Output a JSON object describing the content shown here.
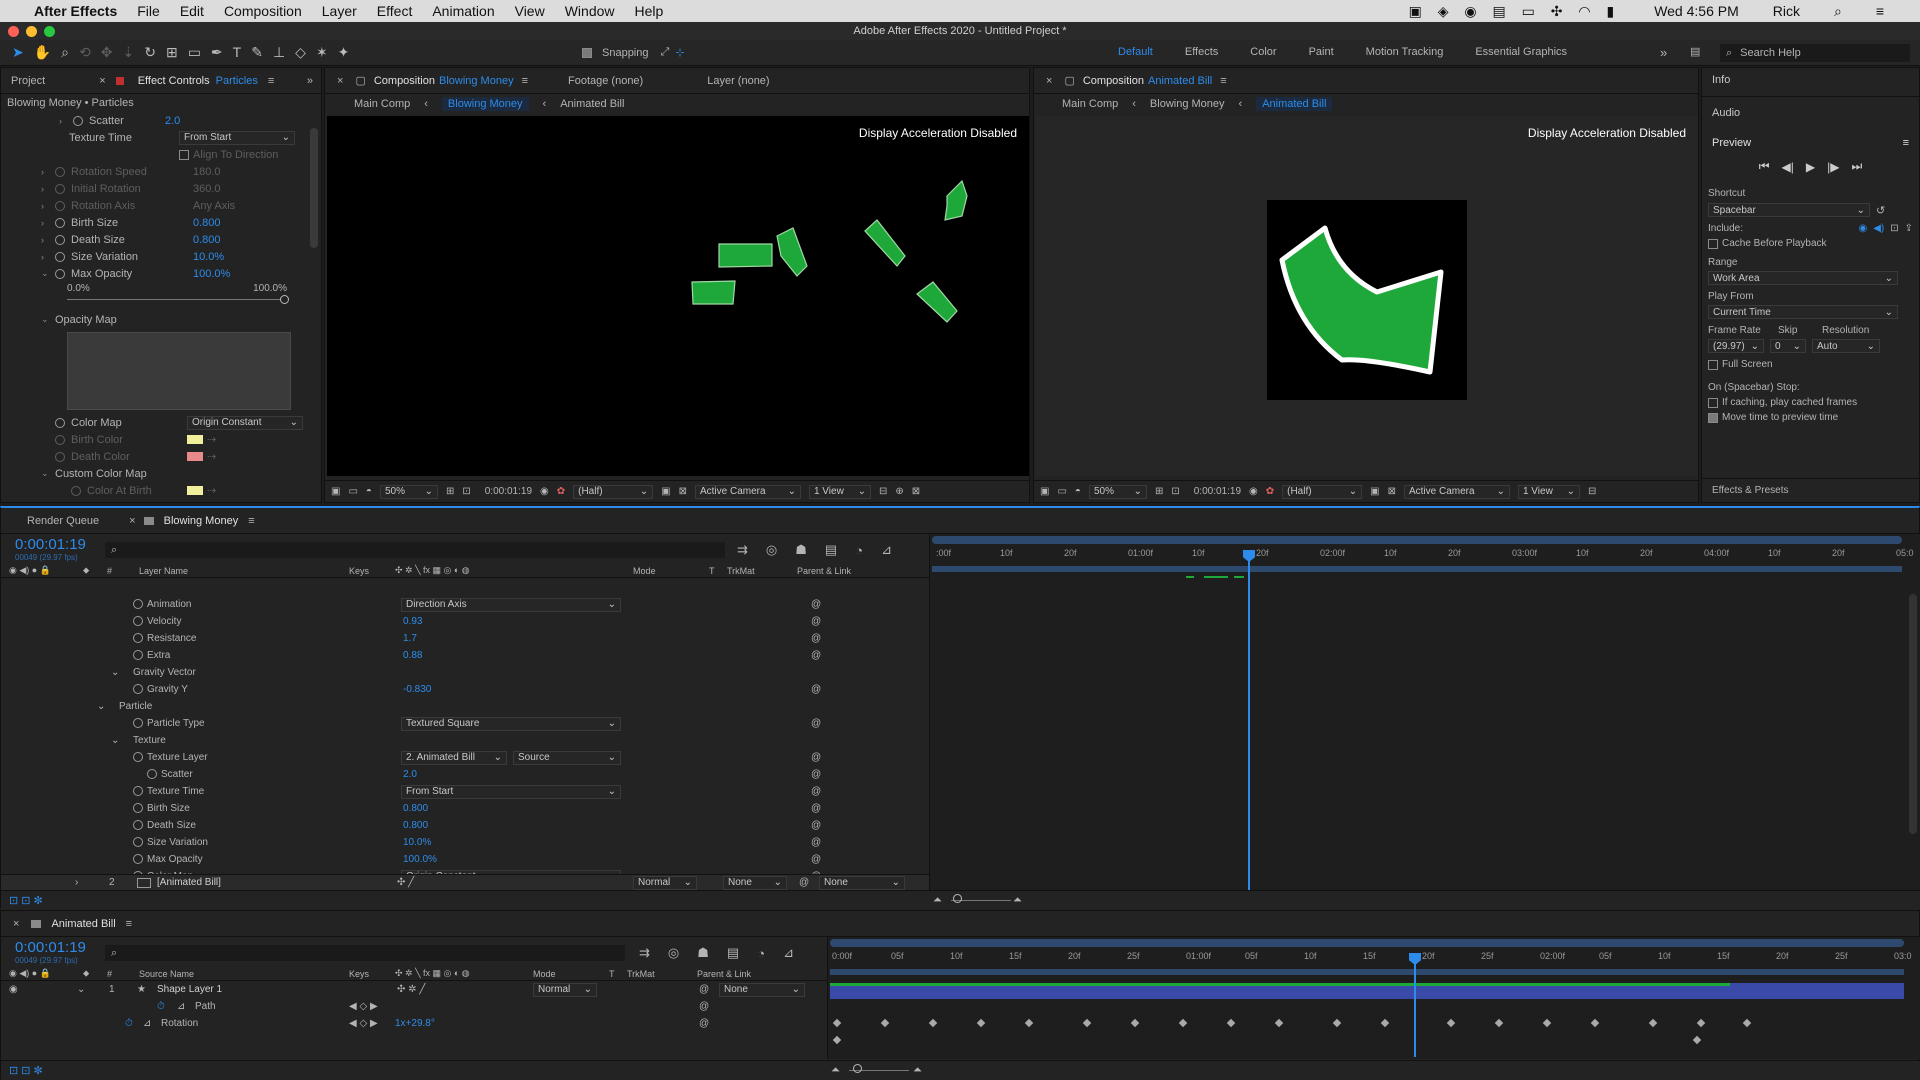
{
  "menubar": {
    "apple": "",
    "app": "After Effects",
    "items": [
      "File",
      "Edit",
      "Composition",
      "Layer",
      "Effect",
      "Animation",
      "View",
      "Window",
      "Help"
    ],
    "clock": "Wed 4:56 PM",
    "user": "Rick"
  },
  "window_title": "Adobe After Effects 2020 - Untitled Project *",
  "toolbar": {
    "snapping": "Snapping",
    "workspaces": [
      "Default",
      "Effects",
      "Color",
      "Paint",
      "Motion Tracking",
      "Essential Graphics"
    ],
    "search_placeholder": "Search Help"
  },
  "effect_controls": {
    "tab_project": "Project",
    "tab_label": "Effect Controls",
    "tab_layer": "Particles",
    "breadcrumb": "Blowing Money • Particles",
    "props": [
      {
        "label": "Scatter",
        "value": "2.0"
      },
      {
        "label": "Texture Time",
        "value": "From Start"
      },
      {
        "label": "Align To Direction",
        "value": ""
      },
      {
        "label": "Rotation Speed",
        "value": "180.0"
      },
      {
        "label": "Initial Rotation",
        "value": "360.0"
      },
      {
        "label": "Rotation Axis",
        "value": "Any Axis"
      },
      {
        "label": "Birth Size",
        "value": "0.800"
      },
      {
        "label": "Death Size",
        "value": "0.800"
      },
      {
        "label": "Size Variation",
        "value": "10.0%"
      },
      {
        "label": "Max Opacity",
        "value": "100.0%"
      }
    ],
    "slider_min": "0.0%",
    "slider_max": "100.0%",
    "opacity_map": "Opacity Map",
    "color_map_label": "Color Map",
    "color_map_value": "Origin Constant",
    "birth_color": "Birth Color",
    "death_color": "Death Color",
    "custom_color_map": "Custom Color Map",
    "color_at_birth": "Color At Birth"
  },
  "comp1": {
    "tab_label": "Composition",
    "tab_name": "Blowing Money",
    "footage": "Footage (none)",
    "layer": "Layer (none)",
    "crumbs": [
      "Main Comp",
      "Blowing Money",
      "Animated Bill"
    ],
    "notice": "Display Acceleration Disabled",
    "zoom": "50%",
    "time": "0:00:01:19",
    "res": "(Half)",
    "camera": "Active Camera",
    "views": "1 View"
  },
  "comp2": {
    "tab_label": "Composition",
    "tab_name": "Animated Bill",
    "crumbs": [
      "Main Comp",
      "Blowing Money",
      "Animated Bill"
    ],
    "notice": "Display Acceleration Disabled",
    "zoom": "50%",
    "time": "0:00:01:19",
    "res": "(Half)",
    "camera": "Active Camera",
    "views": "1 View"
  },
  "right_panel": {
    "info": "Info",
    "audio": "Audio",
    "preview": "Preview",
    "shortcut_label": "Shortcut",
    "shortcut": "Spacebar",
    "include": "Include:",
    "cache": "Cache Before Playback",
    "range_label": "Range",
    "range": "Work Area",
    "play_from_label": "Play From",
    "play_from": "Current Time",
    "frame_rate_label": "Frame Rate",
    "skip_label": "Skip",
    "resolution_label": "Resolution",
    "frame_rate": "(29.97)",
    "skip": "0",
    "resolution": "Auto",
    "full_screen": "Full Screen",
    "on_stop": "On (Spacebar) Stop:",
    "if_caching": "If caching, play cached frames",
    "move_time": "Move time to preview time",
    "effects_presets": "Effects & Presets"
  },
  "timeline1": {
    "tab_render": "Render Queue",
    "tab_comp": "Blowing Money",
    "time": "0:00:01:19",
    "fps": "00049 (29.97 fps)",
    "col_layer": "Layer Name",
    "col_keys": "Keys",
    "col_mode": "Mode",
    "col_t": "T",
    "col_trkmat": "TrkMat",
    "col_parent": "Parent & Link",
    "ruler": [
      ":00f",
      "10f",
      "20f",
      "01:00f",
      "10f",
      "20f",
      "02:00f",
      "10f",
      "20f",
      "03:00f",
      "10f",
      "20f",
      "04:00f",
      "10f",
      "20f",
      "05:0"
    ],
    "rows": [
      {
        "indent": 3,
        "label": "Animation",
        "value": "Direction Axis",
        "dd": true,
        "stop": false
      },
      {
        "indent": 3,
        "label": "Velocity",
        "value": "0.93",
        "stop": true
      },
      {
        "indent": 3,
        "label": "Resistance",
        "value": "1.7",
        "stop": true
      },
      {
        "indent": 3,
        "label": "Extra",
        "value": "0.88",
        "stop": true
      },
      {
        "indent": 2,
        "label": "Gravity Vector",
        "value": "",
        "tri": true
      },
      {
        "indent": 3,
        "label": "Gravity Y",
        "value": "-0.830",
        "stop": false
      },
      {
        "indent": 1,
        "label": "Particle",
        "value": "",
        "tri": true
      },
      {
        "indent": 3,
        "label": "Particle Type",
        "value": "Textured Square",
        "dd": true,
        "stop": true
      },
      {
        "indent": 2,
        "label": "Texture",
        "value": "",
        "tri": true
      },
      {
        "indent": 3,
        "label": "Texture Layer",
        "value": "2. Animated Bill",
        "value2": "Source",
        "dd": true
      },
      {
        "indent": 4,
        "label": "Scatter",
        "value": "2.0",
        "stop": true
      },
      {
        "indent": 3,
        "label": "Texture Time",
        "value": "From Start",
        "dd": true
      },
      {
        "indent": 3,
        "label": "Birth Size",
        "value": "0.800",
        "stop": true
      },
      {
        "indent": 3,
        "label": "Death Size",
        "value": "0.800",
        "stop": true
      },
      {
        "indent": 3,
        "label": "Size Variation",
        "value": "10.0%",
        "stop": true
      },
      {
        "indent": 3,
        "label": "Max Opacity",
        "value": "100.0%",
        "stop": true
      },
      {
        "indent": 3,
        "label": "Color Map",
        "value": "Origin Constant",
        "dd": true,
        "stop": true
      }
    ],
    "layer2": {
      "num": "2",
      "name": "[Animated Bill]",
      "mode": "Normal",
      "trkmat": "None",
      "parent": "None"
    }
  },
  "timeline2": {
    "tab": "Animated Bill",
    "time": "0:00:01:19",
    "fps": "00049 (29.97 fps)",
    "col_source": "Source Name",
    "col_keys": "Keys",
    "col_mode": "Mode",
    "col_t": "T",
    "col_trkmat": "TrkMat",
    "col_parent": "Parent & Link",
    "ruler": [
      "0:00f",
      "05f",
      "10f",
      "15f",
      "20f",
      "25f",
      "01:00f",
      "05f",
      "10f",
      "15f",
      "20f",
      "25f",
      "02:00f",
      "05f",
      "10f",
      "15f",
      "20f",
      "25f",
      "03:0"
    ],
    "layer": {
      "num": "1",
      "name": "Shape Layer 1",
      "mode": "Normal",
      "parent": "None"
    },
    "path": "Path",
    "rotation": "Rotation",
    "rotation_value": "1x+29.8°"
  },
  "colors": {
    "accent": "#2d8ceb",
    "green": "#1fa83a",
    "layer_blue": "#3a4aa8"
  }
}
